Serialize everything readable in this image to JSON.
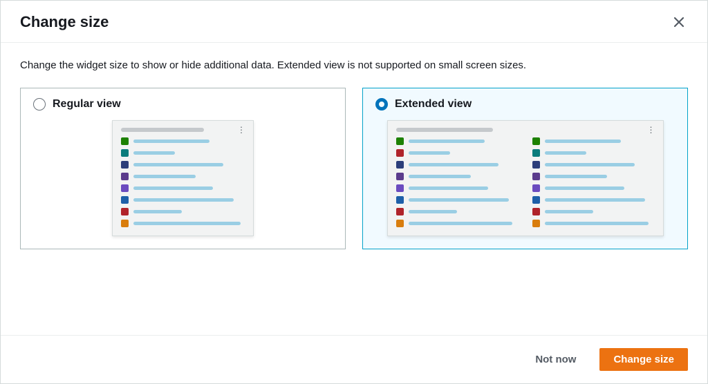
{
  "modal": {
    "title": "Change size",
    "description": "Change the widget size to show or hide additional data. Extended view is not supported on small screen sizes."
  },
  "options": {
    "regular": {
      "label": "Regular view",
      "selected": false
    },
    "extended": {
      "label": "Extended view",
      "selected": true
    }
  },
  "footer": {
    "not_now": "Not now",
    "confirm": "Change size"
  },
  "colors": {
    "accent": "#ec7211",
    "selected_border": "#00a1c9"
  }
}
